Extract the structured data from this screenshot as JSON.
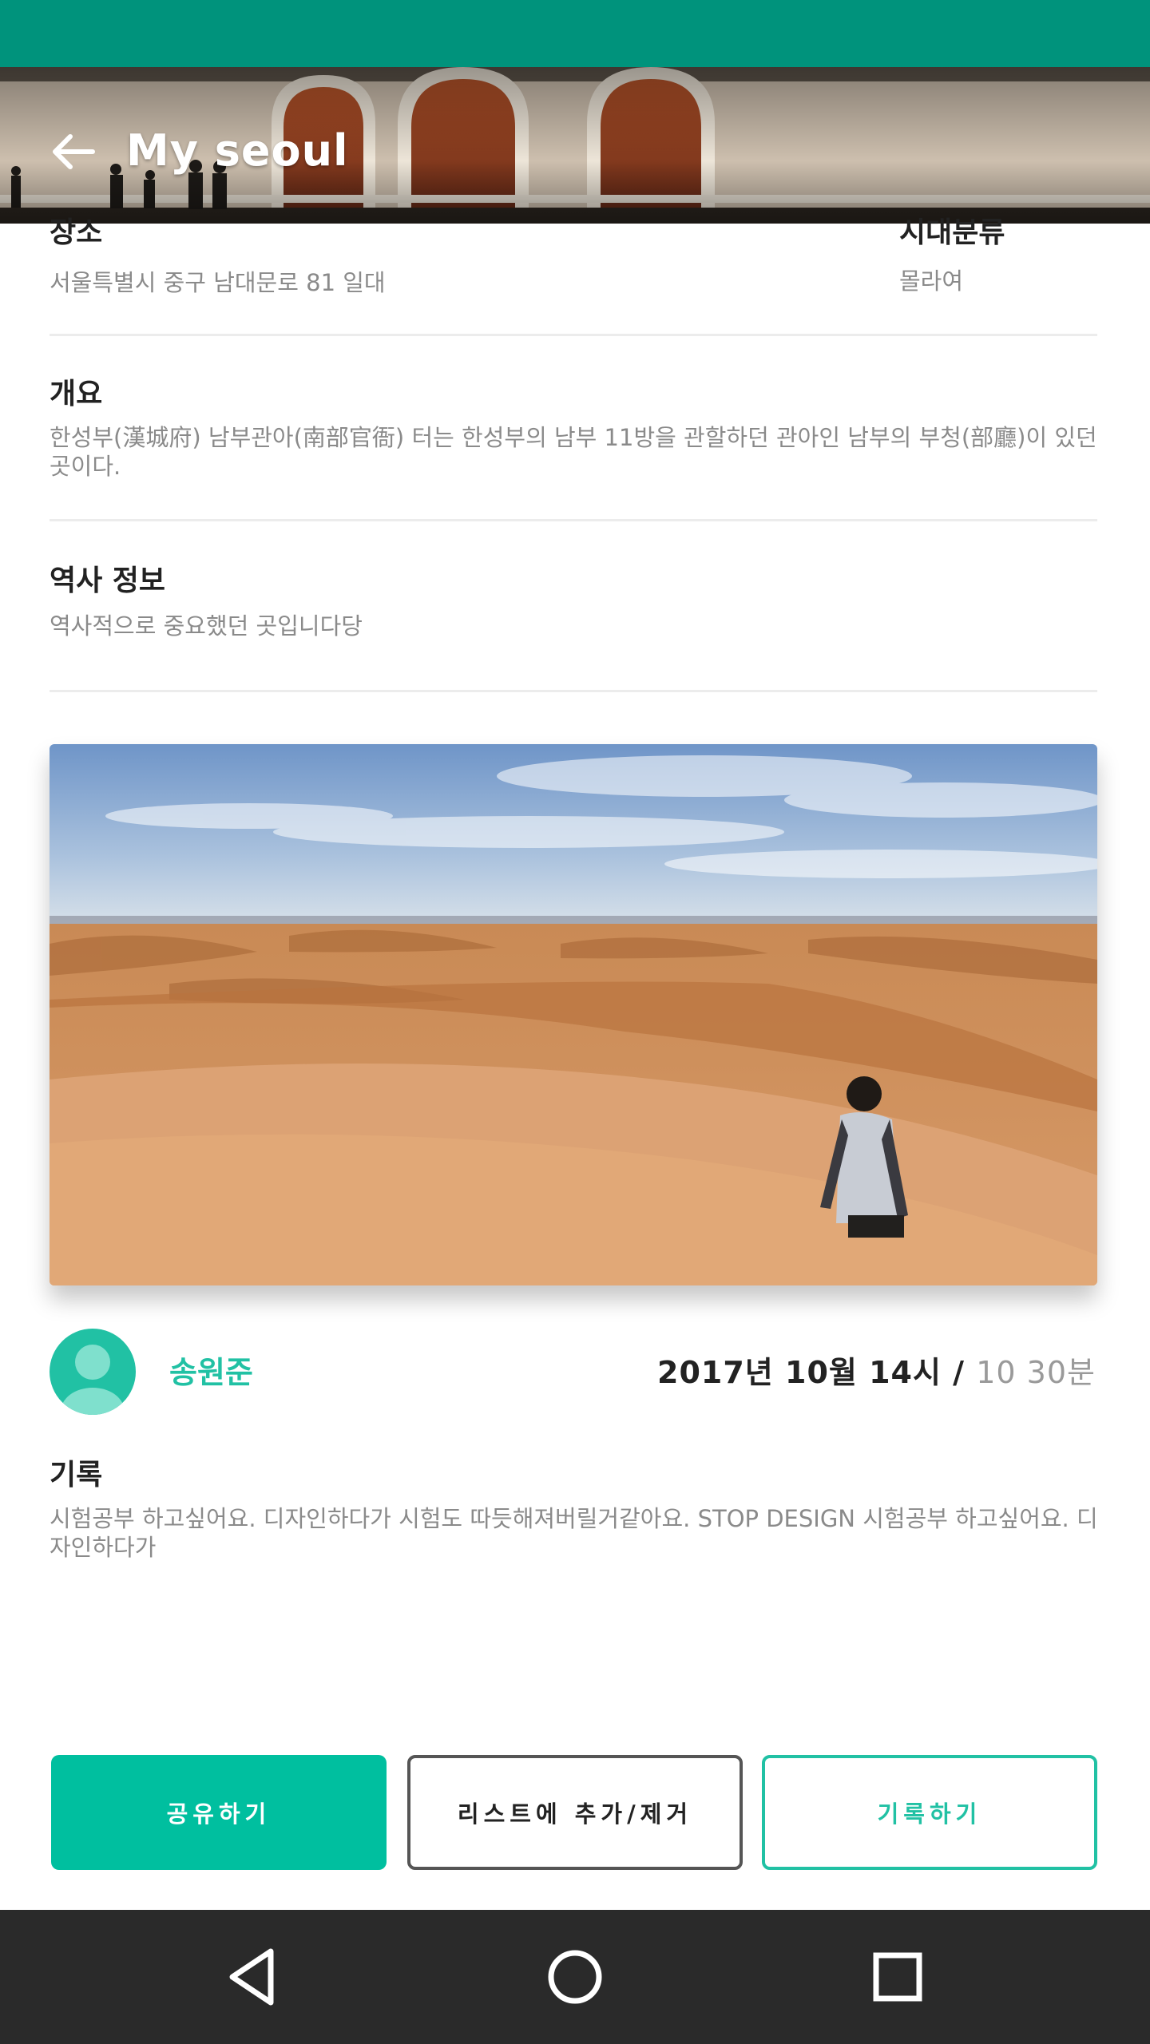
{
  "header": {
    "title": "My seoul",
    "back_icon": "arrow-left-icon"
  },
  "details": {
    "place_label": "장소",
    "place_value": "서울특별시 중구 남대문로 81 일대",
    "era_label": "시대분류",
    "era_value": "몰라여",
    "overview_label": "개요",
    "overview_text": "한성부(漢城府) 남부관아(南部官衙) 터는 한성부의 남부 11방을 관할하던 관아인 남부의 부청(部廳)이 있던 곳이다.",
    "history_label": "역사 정보",
    "history_text": "역사적으로 중요했던 곳입니다당"
  },
  "post": {
    "author": "송원준",
    "date": "2017년 10월 14시 / ",
    "time": "10 30분",
    "record_label": "기록",
    "record_text": "시험공부 하고싶어요. 디자인하다가 시험도 따듯해져버릴거같아요. STOP DESIGN 시험공부 하고싶어요. 디자인하다가"
  },
  "actions": {
    "share": "공유하기",
    "list_toggle": "리스트에 추가/제거",
    "record": "기록하기"
  },
  "colors": {
    "primary": "#00bf9f",
    "status_bar": "#00937c",
    "nav_bar": "#2a2a2a"
  },
  "navbar": {
    "back_icon": "triangle-back-icon",
    "home_icon": "circle-home-icon",
    "recents_icon": "square-recents-icon"
  }
}
